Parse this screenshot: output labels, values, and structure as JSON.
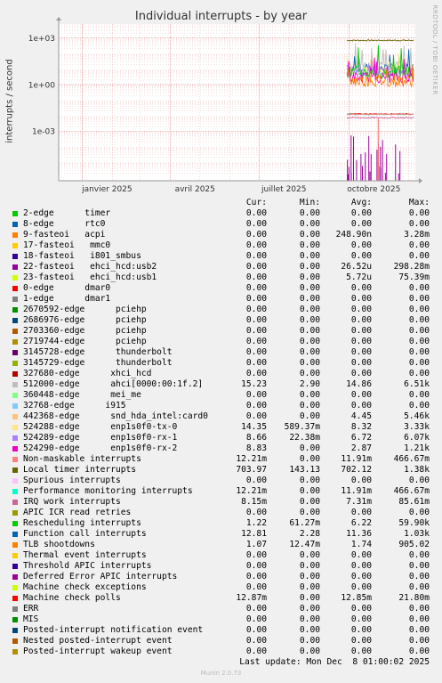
{
  "title": "Individual interrupts - by year",
  "side_label": "RRDTOOL / TOBI OETIKER",
  "footer": "Last update: Mon Dec  8 01:00:02 2025",
  "munin_version": "Munin 2.0.73",
  "legend_headers": [
    "Cur:",
    "Min:",
    "Avg:",
    "Max:"
  ],
  "chart_data": {
    "type": "line",
    "title": "Individual interrupts - by year",
    "ylabel": "interrupts / second",
    "yscale": "log",
    "y_ticks": [
      "1e+03",
      "1e+00",
      "1e-03"
    ],
    "x_ticks": [
      "janvier 2025",
      "avril 2025",
      "juillet 2025",
      "octobre 2025"
    ],
    "grid": true,
    "series": [
      {
        "name": "2-edge      timer",
        "color": "#00cc00",
        "cur": "0.00",
        "min": "0.00",
        "avg": "0.00",
        "max": "0.00"
      },
      {
        "name": "8-edge      rtc0",
        "color": "#0066b3",
        "cur": "0.00",
        "min": "0.00",
        "avg": "0.00",
        "max": "0.00"
      },
      {
        "name": "9-fasteoi   acpi",
        "color": "#ff8000",
        "cur": "0.00",
        "min": "0.00",
        "avg": "248.90n",
        "max": "3.28m"
      },
      {
        "name": "17-fasteoi   mmc0",
        "color": "#ffcc00",
        "cur": "0.00",
        "min": "0.00",
        "avg": "0.00",
        "max": "0.00"
      },
      {
        "name": "18-fasteoi   i801_smbus",
        "color": "#330099",
        "cur": "0.00",
        "min": "0.00",
        "avg": "0.00",
        "max": "0.00"
      },
      {
        "name": "22-fasteoi   ehci_hcd:usb2",
        "color": "#990099",
        "cur": "0.00",
        "min": "0.00",
        "avg": "26.52u",
        "max": "298.28m"
      },
      {
        "name": "23-fasteoi   ehci_hcd:usb1",
        "color": "#ccff00",
        "cur": "0.00",
        "min": "0.00",
        "avg": "5.72u",
        "max": "75.39m"
      },
      {
        "name": "0-edge      dmar0",
        "color": "#ff0000",
        "cur": "0.00",
        "min": "0.00",
        "avg": "0.00",
        "max": "0.00"
      },
      {
        "name": "1-edge      dmar1",
        "color": "#808080",
        "cur": "0.00",
        "min": "0.00",
        "avg": "0.00",
        "max": "0.00"
      },
      {
        "name": "2670592-edge      pciehp",
        "color": "#008f00",
        "cur": "0.00",
        "min": "0.00",
        "avg": "0.00",
        "max": "0.00"
      },
      {
        "name": "2686976-edge      pciehp",
        "color": "#00487d",
        "cur": "0.00",
        "min": "0.00",
        "avg": "0.00",
        "max": "0.00"
      },
      {
        "name": "2703360-edge      pciehp",
        "color": "#b35a00",
        "cur": "0.00",
        "min": "0.00",
        "avg": "0.00",
        "max": "0.00"
      },
      {
        "name": "2719744-edge      pciehp",
        "color": "#b38f00",
        "cur": "0.00",
        "min": "0.00",
        "avg": "0.00",
        "max": "0.00"
      },
      {
        "name": "3145728-edge      thunderbolt",
        "color": "#6b006b",
        "cur": "0.00",
        "min": "0.00",
        "avg": "0.00",
        "max": "0.00"
      },
      {
        "name": "3145729-edge      thunderbolt",
        "color": "#8fb300",
        "cur": "0.00",
        "min": "0.00",
        "avg": "0.00",
        "max": "0.00"
      },
      {
        "name": "327680-edge      xhci_hcd",
        "color": "#b30000",
        "cur": "0.00",
        "min": "0.00",
        "avg": "0.00",
        "max": "0.00"
      },
      {
        "name": "512000-edge      ahci[0000:00:1f.2]",
        "color": "#bebebe",
        "cur": "15.23",
        "min": "2.90",
        "avg": "14.86",
        "max": "6.51k"
      },
      {
        "name": "360448-edge      mei_me",
        "color": "#80ff80",
        "cur": "0.00",
        "min": "0.00",
        "avg": "0.00",
        "max": "0.00"
      },
      {
        "name": "32768-edge      i915",
        "color": "#80c9ff",
        "cur": "0.00",
        "min": "0.00",
        "avg": "0.00",
        "max": "0.00"
      },
      {
        "name": "442368-edge      snd_hda_intel:card0",
        "color": "#ffc080",
        "cur": "0.00",
        "min": "0.00",
        "avg": "4.45",
        "max": "5.46k"
      },
      {
        "name": "524288-edge      enp1s0f0-tx-0",
        "color": "#ffe680",
        "cur": "14.35",
        "min": "589.37m",
        "avg": "8.32",
        "max": "3.33k"
      },
      {
        "name": "524289-edge      enp1s0f0-rx-1",
        "color": "#aa80ff",
        "cur": "8.66",
        "min": "22.38m",
        "avg": "6.72",
        "max": "6.07k"
      },
      {
        "name": "524290-edge      enp1s0f0-rx-2",
        "color": "#ee00cc",
        "cur": "8.83",
        "min": "0.00",
        "avg": "2.87",
        "max": "1.21k"
      },
      {
        "name": "Non-maskable interrupts",
        "color": "#ff8080",
        "cur": "12.21m",
        "min": "0.00",
        "avg": "11.91m",
        "max": "466.67m"
      },
      {
        "name": "Local timer interrupts",
        "color": "#666600",
        "cur": "703.97",
        "min": "143.13",
        "avg": "702.12",
        "max": "1.38k"
      },
      {
        "name": "Spurious interrupts",
        "color": "#ffbfff",
        "cur": "0.00",
        "min": "0.00",
        "avg": "0.00",
        "max": "0.00"
      },
      {
        "name": "Performance monitoring interrupts",
        "color": "#00ffcc",
        "cur": "12.21m",
        "min": "0.00",
        "avg": "11.91m",
        "max": "466.67m"
      },
      {
        "name": "IRQ work interrupts",
        "color": "#cc6699",
        "cur": "8.15m",
        "min": "0.00",
        "avg": "7.31m",
        "max": "85.61m"
      },
      {
        "name": "APIC ICR read retries",
        "color": "#999900",
        "cur": "0.00",
        "min": "0.00",
        "avg": "0.00",
        "max": "0.00"
      },
      {
        "name": "Rescheduling interrupts",
        "color": "#00cc00",
        "cur": "1.22",
        "min": "61.27m",
        "avg": "6.22",
        "max": "59.90k"
      },
      {
        "name": "Function call interrupts",
        "color": "#0066b3",
        "cur": "12.81",
        "min": "2.28",
        "avg": "11.36",
        "max": "1.03k"
      },
      {
        "name": "TLB shootdowns",
        "color": "#ff8000",
        "cur": "1.07",
        "min": "12.47m",
        "avg": "1.74",
        "max": "905.02"
      },
      {
        "name": "Thermal event interrupts",
        "color": "#ffcc00",
        "cur": "0.00",
        "min": "0.00",
        "avg": "0.00",
        "max": "0.00"
      },
      {
        "name": "Threshold APIC interrupts",
        "color": "#330099",
        "cur": "0.00",
        "min": "0.00",
        "avg": "0.00",
        "max": "0.00"
      },
      {
        "name": "Deferred Error APIC interrupts",
        "color": "#990099",
        "cur": "0.00",
        "min": "0.00",
        "avg": "0.00",
        "max": "0.00"
      },
      {
        "name": "Machine check exceptions",
        "color": "#ccff00",
        "cur": "0.00",
        "min": "0.00",
        "avg": "0.00",
        "max": "0.00"
      },
      {
        "name": "Machine check polls",
        "color": "#ff0000",
        "cur": "12.87m",
        "min": "0.00",
        "avg": "12.85m",
        "max": "21.80m"
      },
      {
        "name": "ERR",
        "color": "#808080",
        "cur": "0.00",
        "min": "0.00",
        "avg": "0.00",
        "max": "0.00"
      },
      {
        "name": "MIS",
        "color": "#008f00",
        "cur": "0.00",
        "min": "0.00",
        "avg": "0.00",
        "max": "0.00"
      },
      {
        "name": "Posted-interrupt notification event",
        "color": "#00487d",
        "cur": "0.00",
        "min": "0.00",
        "avg": "0.00",
        "max": "0.00"
      },
      {
        "name": "Nested posted-interrupt event",
        "color": "#b35a00",
        "cur": "0.00",
        "min": "0.00",
        "avg": "0.00",
        "max": "0.00"
      },
      {
        "name": "Posted-interrupt wakeup event",
        "color": "#b38f00",
        "cur": "0.00",
        "min": "0.00",
        "avg": "0.00",
        "max": "0.00"
      }
    ]
  }
}
